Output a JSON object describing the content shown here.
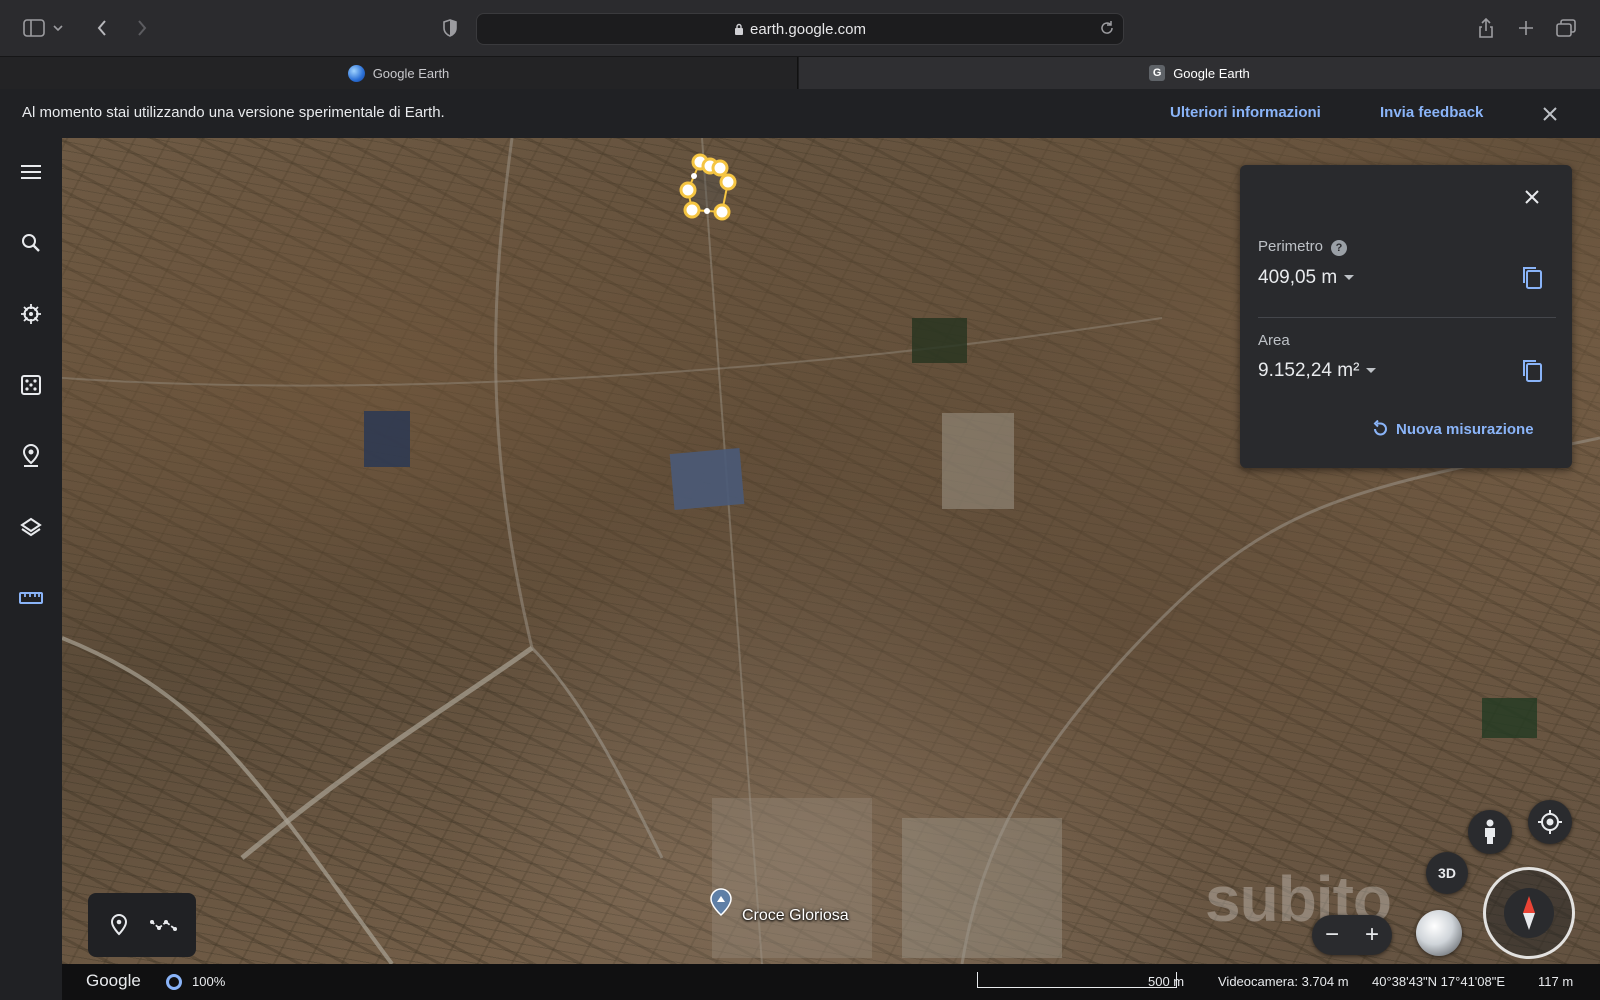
{
  "browser": {
    "url": "earth.google.com",
    "tabs": [
      {
        "title": "Google Earth",
        "active": false
      },
      {
        "title": "Google Earth",
        "active": true
      }
    ]
  },
  "banner": {
    "message": "Al momento stai utilizzando una versione sperimentale di Earth.",
    "learn_more": "Ulteriori informazioni",
    "feedback": "Invia feedback"
  },
  "sidebar": {
    "items": [
      {
        "icon": "menu-icon"
      },
      {
        "icon": "search-icon"
      },
      {
        "icon": "voyager-icon"
      },
      {
        "icon": "dice-icon"
      },
      {
        "icon": "projects-icon"
      },
      {
        "icon": "layers-icon"
      },
      {
        "icon": "ruler-icon",
        "active": true
      }
    ]
  },
  "map": {
    "place_label": "Croce Gloriosa"
  },
  "measure_panel": {
    "perimeter_label": "Perimetro",
    "perimeter_value": "409,05 m",
    "area_label": "Area",
    "area_value": "9.152,24 m²",
    "new_measure": "Nuova misurazione"
  },
  "controls": {
    "btn_3d": "3D",
    "zoom_out": "−",
    "zoom_in": "+"
  },
  "watermark": "subito",
  "status": {
    "brand": "Google",
    "load_percent": "100%",
    "scale_label": "500 m",
    "camera": "Videocamera: 3.704 m",
    "coords": "40°38'43\"N 17°41'08\"E",
    "elevation": "117 m"
  },
  "colors": {
    "accent": "#8ab4f8",
    "panel": "#292a2d",
    "rail": "#202124",
    "measure": "#f5c542"
  }
}
